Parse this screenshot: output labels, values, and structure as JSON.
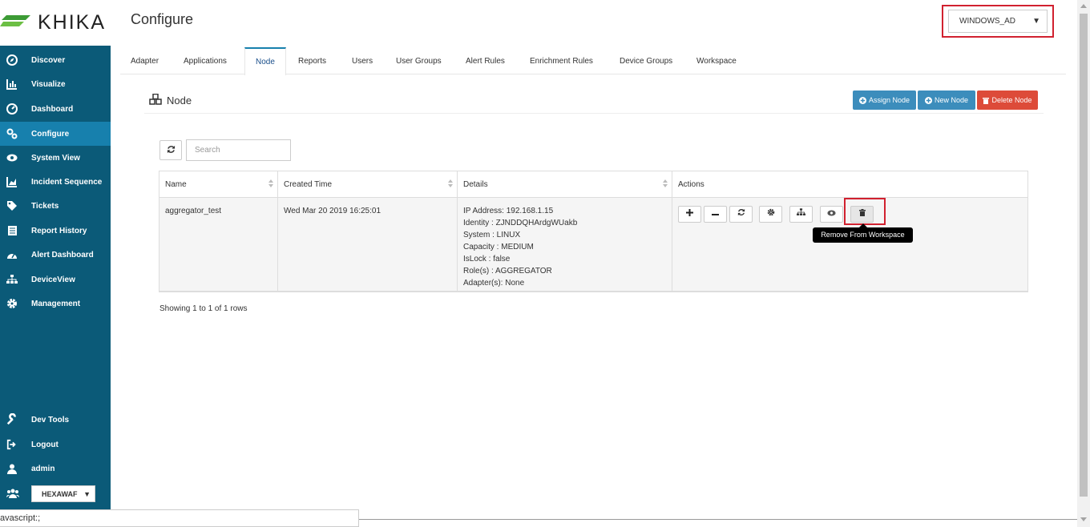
{
  "app": {
    "brand": "KHIKA",
    "page_title": "Configure"
  },
  "workspace_select": {
    "value": "WINDOWS_AD",
    "arrow": "▼"
  },
  "sidebar": {
    "items": [
      {
        "label": "Discover",
        "icon": "compass-icon"
      },
      {
        "label": "Visualize",
        "icon": "bar-chart-icon"
      },
      {
        "label": "Dashboard",
        "icon": "dashboard-icon"
      },
      {
        "label": "Configure",
        "icon": "gears-icon",
        "active": true
      },
      {
        "label": "System View",
        "icon": "eye-icon"
      },
      {
        "label": "Incident Sequence",
        "icon": "area-chart-icon"
      },
      {
        "label": "Tickets",
        "icon": "tag-icon"
      },
      {
        "label": "Report History",
        "icon": "newspaper-icon"
      },
      {
        "label": "Alert Dashboard",
        "icon": "tachometer-icon"
      },
      {
        "label": "DeviceView",
        "icon": "sitemap-icon"
      },
      {
        "label": "Management",
        "icon": "cog-icon"
      }
    ],
    "bottom_items": [
      {
        "label": "Dev Tools",
        "icon": "wrench-icon"
      },
      {
        "label": "Logout",
        "icon": "sign-out-icon"
      },
      {
        "label": "admin",
        "icon": "user-icon"
      }
    ],
    "user_workspace": {
      "value": "HEXAWAF",
      "arrow": "▼"
    }
  },
  "tabs": [
    "Adapter",
    "Applications",
    "Node",
    "Reports",
    "Users",
    "User Groups",
    "Alert Rules",
    "Enrichment Rules",
    "Device Groups",
    "Workspace"
  ],
  "active_tab": "Node",
  "panel": {
    "title": "Node",
    "buttons": {
      "assign": "Assign Node",
      "new": "New Node",
      "delete": "Delete Node"
    }
  },
  "search": {
    "placeholder": "Search",
    "value": ""
  },
  "table": {
    "columns": [
      "Name",
      "Created Time",
      "Details",
      "Actions"
    ],
    "rows": [
      {
        "name": "aggregator_test",
        "created": "Wed Mar 20 2019 16:25:01",
        "details": [
          "IP Address: 192.168.1.15",
          "Identity : ZJNDDQHArdgWUakb",
          "System : LINUX",
          "Capacity : MEDIUM",
          "IsLock : false",
          "Role(s) : AGGREGATOR",
          "Adapter(s): None"
        ]
      }
    ],
    "tooltip": "Remove From Workspace",
    "footer": "Showing 1 to 1 of 1 rows"
  },
  "status_bar": "avascript:;",
  "colors": {
    "sidebar": "#0b5a78",
    "sidebar_active": "#1780ad",
    "btn_blue": "#3c8dbc",
    "btn_red": "#dd4b39",
    "highlight": "#d1212f"
  }
}
